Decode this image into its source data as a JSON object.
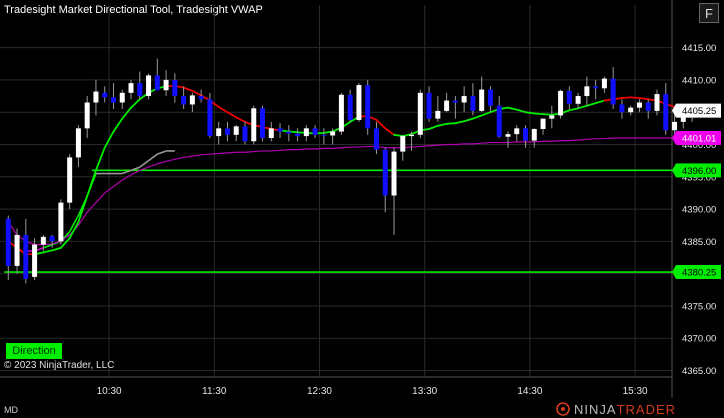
{
  "header": {
    "title": "Tradesight Market Directional Tool, Tradesight VWAP",
    "f_button": "F"
  },
  "footer": {
    "direction_button": "Direction",
    "copyright": "© 2023 NinjaTrader, LLC",
    "md_label": "MD",
    "brand_ninja": "NINJA",
    "brand_trader": "TRADER"
  },
  "chart_data": {
    "type": "candlestick",
    "time_labels": [
      "10:30",
      "11:30",
      "12:30",
      "13:30",
      "14:30",
      "15:30"
    ],
    "time_positions_minutes": [
      60,
      120,
      180,
      240,
      300,
      360
    ],
    "start_time": "09:30",
    "bar_interval_minutes": 5,
    "y_ticks": [
      4415,
      4410,
      4405,
      4400,
      4395,
      4390,
      4385,
      4380,
      4375,
      4370,
      4365
    ],
    "ylim": [
      4364,
      4418.5
    ],
    "y_tick_labels": [
      "4415.00",
      "4410.00",
      "4405.00",
      "4400.00",
      "4395.00",
      "4390.00",
      "4385.00",
      "4380.00",
      "4375.00",
      "4370.00",
      "4365.00"
    ],
    "price_tags": [
      {
        "label": "4405.25",
        "value": 4405.25,
        "color": "#ffffff",
        "text": "#000000"
      },
      {
        "label": "4401.01",
        "value": 4401.01,
        "color": "#ee00ee",
        "text": "#ffffff"
      },
      {
        "label": "4396.00",
        "value": 4396.0,
        "color": "#00ee00",
        "text": "#000000"
      },
      {
        "label": "4380.25",
        "value": 4380.25,
        "color": "#00ee00",
        "text": "#000000"
      }
    ],
    "horizontal_lines": [
      {
        "value": 4396.0,
        "start_bar": 10,
        "color": "#00ee00"
      },
      {
        "value": 4380.25,
        "start_bar": 0,
        "color": "#00ee00"
      }
    ],
    "series_colors": {
      "up_bar": "#ffffff",
      "down_bar": "#1010ff",
      "up_line": "#00ee00",
      "down_line": "#ee0000",
      "vwap": "#b000b0",
      "trail_up": "#00ee00",
      "trail_neutral": "#999999",
      "trail_magenta": "#cc00cc"
    },
    "candles": [
      [
        4388.5,
        4389,
        4379,
        4381.2
      ],
      [
        4381.2,
        4387,
        4380,
        4386
      ],
      [
        4386,
        4388.5,
        4378.5,
        4379.2
      ],
      [
        4379.5,
        4385.5,
        4379,
        4384.5
      ],
      [
        4384.5,
        4386,
        4383.5,
        4385.7
      ],
      [
        4385.8,
        4386,
        4384,
        4385
      ],
      [
        4385,
        4391.5,
        4384.5,
        4391
      ],
      [
        4391,
        4398.5,
        4390,
        4398
      ],
      [
        4398,
        4403,
        4396.5,
        4402.5
      ],
      [
        4402.5,
        4407.5,
        4401,
        4406.5
      ],
      [
        4406.5,
        4410,
        4404.5,
        4408.2
      ],
      [
        4408,
        4409,
        4406.5,
        4407.3
      ],
      [
        4407.3,
        4409.5,
        4405.5,
        4406.5
      ],
      [
        4406.5,
        4408.5,
        4405.5,
        4408
      ],
      [
        4408,
        4410,
        4407,
        4409.5
      ],
      [
        4409.5,
        4411.3,
        4407,
        4407.5
      ],
      [
        4407.5,
        4411,
        4407,
        4410.7
      ],
      [
        4410.7,
        4413.3,
        4409,
        4408.4
      ],
      [
        4408.4,
        4411.5,
        4407.5,
        4410
      ],
      [
        4410,
        4411,
        4406.5,
        4407.5
      ],
      [
        4407.5,
        4409,
        4405.5,
        4406.2
      ],
      [
        4406.2,
        4408,
        4405,
        4407.6
      ],
      [
        4407.5,
        4408.5,
        4406.5,
        4407
      ],
      [
        4407,
        4408,
        4401,
        4401.3
      ],
      [
        4401.3,
        4403.5,
        4400,
        4402.5
      ],
      [
        4402.5,
        4403.5,
        4400.5,
        4401.5
      ],
      [
        4401.5,
        4403,
        4400.5,
        4402.8
      ],
      [
        4402.8,
        4403.5,
        4400,
        4400.5
      ],
      [
        4400.5,
        4406,
        4400,
        4405.6
      ],
      [
        4405.6,
        4406,
        4400.5,
        4401
      ],
      [
        4401,
        4403.5,
        4400.5,
        4402.5
      ],
      [
        4402.5,
        4403.3,
        4401,
        4402
      ],
      [
        4402,
        4403,
        4400.5,
        4401.7
      ],
      [
        4401.7,
        4402.5,
        4400.5,
        4401.3
      ],
      [
        4401.3,
        4403,
        4400.5,
        4402.5
      ],
      [
        4402.5,
        4403,
        4401,
        4401.5
      ],
      [
        4401.5,
        4402.5,
        4400,
        4401.4
      ],
      [
        4401.4,
        4402.5,
        4400,
        4402
      ],
      [
        4402,
        4408,
        4401.5,
        4407.7
      ],
      [
        4407.7,
        4408.5,
        4403.5,
        4403.8
      ],
      [
        4403.8,
        4409.5,
        4403.5,
        4409.2
      ],
      [
        4409.2,
        4410,
        4401.5,
        4402.5
      ],
      [
        4402.5,
        4403.5,
        4398.5,
        4399.2
      ],
      [
        4399.2,
        4399.5,
        4389.5,
        4392.1
      ],
      [
        4392.1,
        4399.5,
        4386,
        4398.9
      ],
      [
        4398.9,
        4401.5,
        4397.5,
        4401.3
      ],
      [
        4401.3,
        4402,
        4399,
        4401.5
      ],
      [
        4401.5,
        4408.5,
        4401,
        4408
      ],
      [
        4408,
        4409,
        4403.5,
        4404
      ],
      [
        4404,
        4407.5,
        4403.5,
        4405.2
      ],
      [
        4405.2,
        4408,
        4405,
        4406.8
      ],
      [
        4406.8,
        4407.5,
        4404,
        4406.5
      ],
      [
        4406.5,
        4409,
        4405,
        4407.5
      ],
      [
        4407.5,
        4409.5,
        4404.5,
        4405.2
      ],
      [
        4405.2,
        4410.5,
        4405,
        4408.5
      ],
      [
        4408.5,
        4409,
        4405,
        4406
      ],
      [
        4406,
        4407.5,
        4401,
        4401.2
      ],
      [
        4401.2,
        4402,
        4399.5,
        4401.6
      ],
      [
        4401.6,
        4403,
        4400.5,
        4402.5
      ],
      [
        4402.5,
        4403,
        4399.5,
        4400.6
      ],
      [
        4400.6,
        4402.5,
        4399.5,
        4402.4
      ],
      [
        4402.4,
        4404,
        4401.5,
        4404
      ],
      [
        4404,
        4406,
        4402.5,
        4404.5
      ],
      [
        4404.5,
        4408.5,
        4404,
        4408.3
      ],
      [
        4408.3,
        4409,
        4405.5,
        4406.3
      ],
      [
        4406.3,
        4408,
        4405.5,
        4407.5
      ],
      [
        4407.5,
        4410.5,
        4406,
        4409
      ],
      [
        4409,
        4410,
        4407,
        4408.7
      ],
      [
        4408.7,
        4410.5,
        4408,
        4410.2
      ],
      [
        4410.2,
        4412,
        4405.5,
        4406.2
      ],
      [
        4406.2,
        4407,
        4404,
        4405
      ],
      [
        4405,
        4406,
        4404.5,
        4405.7
      ],
      [
        4405.7,
        4407,
        4405,
        4406.5
      ],
      [
        4406.5,
        4407,
        4404,
        4405.2
      ],
      [
        4405.2,
        4408.5,
        4404.5,
        4407.8
      ],
      [
        4407.8,
        4409.5,
        4401.5,
        4402.2
      ],
      [
        4402.2,
        4404.5,
        4400.5,
        4403.5
      ],
      [
        4403.5,
        4405,
        4402.5,
        4404.5
      ],
      [
        4404.5,
        4405.5,
        4403.5,
        4405.25
      ]
    ],
    "indicator_line": [
      4385,
      4384,
      4383,
      4383,
      4383.3,
      4383.6,
      4384,
      4385.5,
      4388,
      4392,
      4396,
      4399.5,
      4402,
      4404,
      4405.7,
      4407,
      4408,
      4408.7,
      4409,
      4409.1,
      4408.8,
      4408.3,
      4407.6,
      4406.8,
      4405.8,
      4405,
      4404.2,
      4403.5,
      4403,
      4402.7,
      4402.4,
      4402.2,
      4402,
      4401.9,
      4401.8,
      4401.7,
      4401.8,
      4402,
      4402.6,
      4403.5,
      4404.3,
      4404.4,
      4403.8,
      4402.5,
      4401.5,
      4401.3,
      4401.6,
      4402.2,
      4402.4,
      4402.9,
      4403.2,
      4403.3,
      4403.6,
      4404,
      4404.5,
      4405,
      4405.5,
      4405.7,
      4405.4,
      4405,
      4404.8,
      4404.7,
      4404.6,
      4404.8,
      4405.3,
      4405.6,
      4406,
      4406.4,
      4406.8,
      4407,
      4407.2,
      4407.3,
      4407.2,
      4407,
      4406.8,
      4406.3,
      4405.8,
      4405.3,
      4405
    ],
    "indicator_direction": [
      "d",
      "d",
      "d",
      "d",
      "u",
      "u",
      "u",
      "u",
      "u",
      "u",
      "u",
      "u",
      "u",
      "u",
      "u",
      "u",
      "u",
      "u",
      "u",
      "d",
      "d",
      "d",
      "d",
      "d",
      "d",
      "d",
      "d",
      "d",
      "d",
      "d",
      "d",
      "d",
      "u",
      "u",
      "u",
      "u",
      "u",
      "u",
      "u",
      "u",
      "u",
      "d",
      "d",
      "d",
      "d",
      "u",
      "u",
      "u",
      "u",
      "u",
      "u",
      "u",
      "u",
      "u",
      "u",
      "u",
      "u",
      "u",
      "u",
      "u",
      "u",
      "u",
      "u",
      "u",
      "u",
      "u",
      "u",
      "u",
      "u",
      "d",
      "d",
      "d",
      "d",
      "d",
      "d",
      "d",
      "d",
      "d",
      "d"
    ],
    "vwap_line": [
      4388,
      4386,
      4385,
      4384.5,
      4384.5,
      4384.6,
      4385,
      4386,
      4387.5,
      4389.5,
      4391,
      4392.5,
      4393.5,
      4394.5,
      4395.3,
      4396,
      4396.5,
      4397,
      4397.4,
      4397.7,
      4398,
      4398.2,
      4398.4,
      4398.5,
      4398.6,
      4398.7,
      4398.8,
      4398.8,
      4398.9,
      4399,
      4399,
      4399.1,
      4399.2,
      4399.2,
      4399.3,
      4399.3,
      4399.4,
      4399.4,
      4399.5,
      4399.6,
      4399.6,
      4399.7,
      4399.7,
      4399.5,
      4399.5,
      4399.5,
      4399.6,
      4399.7,
      4399.8,
      4399.9,
      4400,
      4400,
      4400.1,
      4400.1,
      4400.2,
      4400.3,
      4400.3,
      4400.3,
      4400.4,
      4400.4,
      4400.4,
      4400.5,
      4400.5,
      4400.6,
      4400.6,
      4400.7,
      4400.8,
      4400.9,
      4400.9,
      4401,
      4401,
      4401,
      4401,
      4401,
      4401,
      4401,
      4401,
      4401,
      4401.01
    ],
    "trail_line": [
      null,
      null,
      4383.5,
      4383.5,
      4384,
      4384.5,
      4385,
      4386.5,
      4389,
      4392,
      4395.5,
      4395.5,
      4395.5,
      4395.5,
      4396,
      4396.5,
      4397.5,
      4398.5,
      4399,
      4399
    ]
  }
}
